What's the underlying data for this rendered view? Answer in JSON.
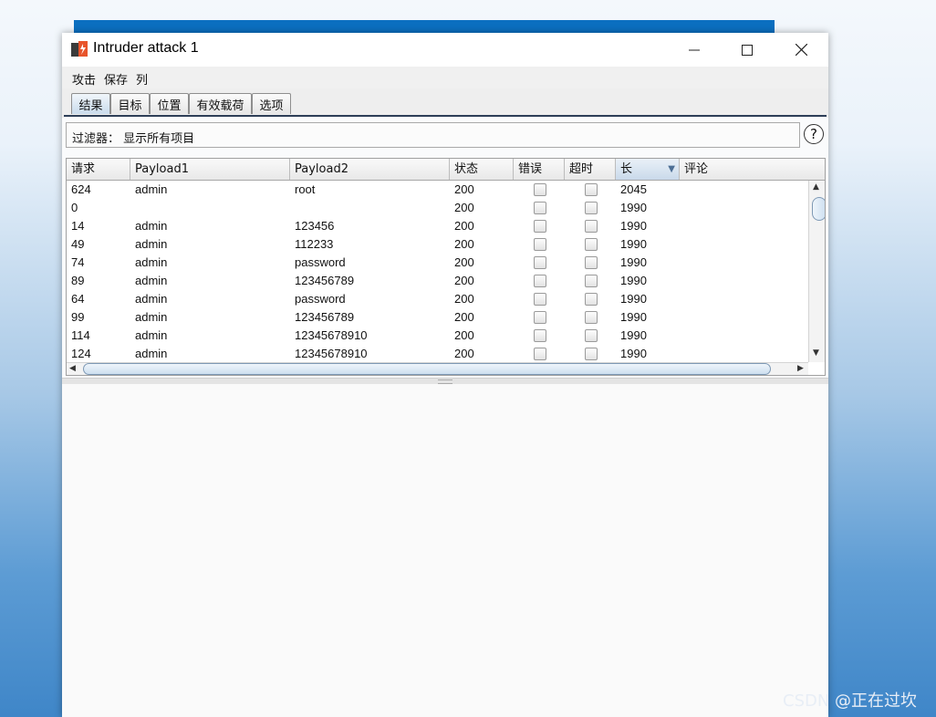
{
  "window": {
    "title": "Intruder attack 1"
  },
  "menu": [
    "攻击",
    "保存",
    "列"
  ],
  "tabs": [
    {
      "label": "结果",
      "active": true
    },
    {
      "label": "目标",
      "active": false
    },
    {
      "label": "位置",
      "active": false
    },
    {
      "label": "有效载荷",
      "active": false
    },
    {
      "label": "选项",
      "active": false
    }
  ],
  "filter": {
    "text": "过滤器： 显示所有项目"
  },
  "help": {
    "symbol": "?"
  },
  "table": {
    "columns": [
      "请求",
      "Payload1",
      "Payload2",
      "状态",
      "错误",
      "超时",
      "长",
      "评论"
    ],
    "sorted_column": "长",
    "rows": [
      {
        "request": "624",
        "payload1": "admin",
        "payload2": "root",
        "status": "200",
        "error": false,
        "timeout": false,
        "length": "2045",
        "comment": ""
      },
      {
        "request": "0",
        "payload1": "",
        "payload2": "",
        "status": "200",
        "error": false,
        "timeout": false,
        "length": "1990",
        "comment": ""
      },
      {
        "request": "14",
        "payload1": "admin",
        "payload2": "123456",
        "status": "200",
        "error": false,
        "timeout": false,
        "length": "1990",
        "comment": ""
      },
      {
        "request": "49",
        "payload1": "admin",
        "payload2": "112233",
        "status": "200",
        "error": false,
        "timeout": false,
        "length": "1990",
        "comment": ""
      },
      {
        "request": "74",
        "payload1": "admin",
        "payload2": "password",
        "status": "200",
        "error": false,
        "timeout": false,
        "length": "1990",
        "comment": ""
      },
      {
        "request": "89",
        "payload1": "admin",
        "payload2": "123456789",
        "status": "200",
        "error": false,
        "timeout": false,
        "length": "1990",
        "comment": ""
      },
      {
        "request": "64",
        "payload1": "admin",
        "payload2": "password",
        "status": "200",
        "error": false,
        "timeout": false,
        "length": "1990",
        "comment": ""
      },
      {
        "request": "99",
        "payload1": "admin",
        "payload2": "123456789",
        "status": "200",
        "error": false,
        "timeout": false,
        "length": "1990",
        "comment": ""
      },
      {
        "request": "114",
        "payload1": "admin",
        "payload2": "12345678910",
        "status": "200",
        "error": false,
        "timeout": false,
        "length": "1990",
        "comment": ""
      },
      {
        "request": "124",
        "payload1": "admin",
        "payload2": "12345678910",
        "status": "200",
        "error": false,
        "timeout": false,
        "length": "1990",
        "comment": ""
      }
    ]
  },
  "watermark": "CSDN @正在过坎",
  "colors": {
    "accent": "#0b6fc0",
    "sorted_header": "#c9d9ea",
    "app_icon": "#e8542b"
  }
}
